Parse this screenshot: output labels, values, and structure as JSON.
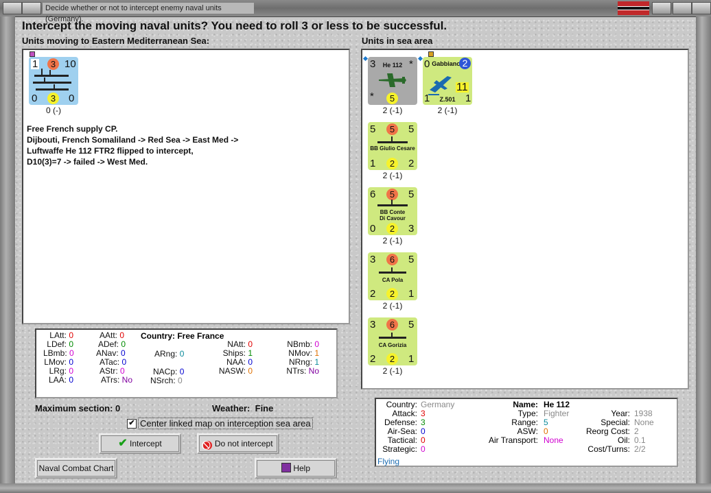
{
  "window": {
    "title": "Decide whether or not to intercept enemy naval units (Germany)."
  },
  "heading": "Intercept the moving naval units?  You need to roll 3 or less to be successful.",
  "left_label": "Units moving to Eastern Mediterranean Sea:",
  "right_label": "Units in sea area",
  "moving_unit": {
    "att": "1",
    "def_circle": "3",
    "move": "10",
    "b_left": "0",
    "b_mid": "3",
    "b_right": "0",
    "caption": "0 (-)"
  },
  "log": [
    "Free French supply CP.",
    "Dijbouti, French Somaliland -> Red Sea -> East Med ->",
    "Luftwaffe He 112 FTR2 flipped to intercept,",
    "D10(3)=7 -> failed -> West Med."
  ],
  "sea_units": [
    {
      "name": "He 112",
      "tl": "3",
      "tr": "*",
      "bl": "*",
      "bm": "5",
      "br": "",
      "caption": "2 (-1)",
      "color": "#a9a9a9"
    },
    {
      "name": "Gabbiano",
      "name2": "Z.501",
      "tl": "0",
      "tc": "2",
      "bm": "11",
      "bl": "1",
      "br": "1",
      "caption": "2 (-1)",
      "color": "#cfe97f"
    },
    {
      "name": "BB Giulio Cesare",
      "tl": "5",
      "tc": "5",
      "tr": "5",
      "bl": "1",
      "bm": "2",
      "br": "2",
      "caption": "2 (-1)",
      "color": "#cfe97f"
    },
    {
      "name": "BB Conte",
      "name2": "Di Cavour",
      "tl": "6",
      "tc": "5",
      "tr": "5",
      "bl": "0",
      "bm": "2",
      "br": "3",
      "caption": "2 (-1)",
      "color": "#cfe97f"
    },
    {
      "name": "CA Pola",
      "tl": "3",
      "tc": "6",
      "tr": "5",
      "bl": "2",
      "bm": "2",
      "br": "1",
      "caption": "2 (-1)",
      "color": "#cfe97f"
    },
    {
      "name": "CA Gorizia",
      "tl": "3",
      "tc": "6",
      "tr": "5",
      "bl": "2",
      "bm": "2",
      "br": "1",
      "caption": "2 (-1)",
      "color": "#cfe97f"
    }
  ],
  "stats": {
    "country_label": "Country:",
    "country": "Free France",
    "lines": [
      [
        "LAtt:",
        "0",
        "LDef:",
        "0",
        "LBmb:",
        "0",
        "LMov:",
        "0",
        "LRg:",
        "0",
        "LAA:",
        "0"
      ],
      [
        "AAtt:",
        "0",
        "ADef:",
        "0",
        "ANav:",
        "0",
        "ATac:",
        "0",
        "AStr:",
        "0",
        "ATrs:",
        "No"
      ],
      [
        "ARng:",
        "0",
        "NACp:",
        "0",
        "NSrch:",
        "0"
      ],
      [
        "NAtt:",
        "0",
        "Ships:",
        "1",
        "NAA:",
        "0",
        "NASW:",
        "0"
      ],
      [
        "NBmb:",
        "0",
        "NMov:",
        "1",
        "NRng:",
        "1",
        "NTrs:",
        "No"
      ]
    ]
  },
  "max_section": "Maximum section: 0",
  "weather_label": "Weather:",
  "weather": "Fine",
  "checkbox_label": "Center linked map on interception sea area",
  "buttons": {
    "intercept": "Intercept",
    "no_intercept": "Do not intercept",
    "naval_chart": "Naval Combat Chart",
    "help": "Help"
  },
  "info": {
    "country_label": "Country:",
    "country": "Germany",
    "attack_label": "Attack:",
    "attack": "3",
    "defense_label": "Defense:",
    "defense": "3",
    "airsea_label": "Air-Sea:",
    "airsea": "0",
    "tactical_label": "Tactical:",
    "tactical": "0",
    "strategic_label": "Strategic:",
    "strategic": "0",
    "flying": "Flying",
    "name_label": "Name:",
    "name": "He 112",
    "type_label": "Type:",
    "type": "Fighter",
    "range_label": "Range:",
    "range": "5",
    "asw_label": "ASW:",
    "asw": "0",
    "airtrans_label": "Air Transport:",
    "airtrans": "None",
    "year_label": "Year:",
    "year": "1938",
    "special_label": "Special:",
    "special": "None",
    "reorg_label": "Reorg Cost:",
    "reorg": "2",
    "oil_label": "Oil:",
    "oil": "0.1",
    "cost_label": "Cost/Turns:",
    "cost": "2/2"
  }
}
